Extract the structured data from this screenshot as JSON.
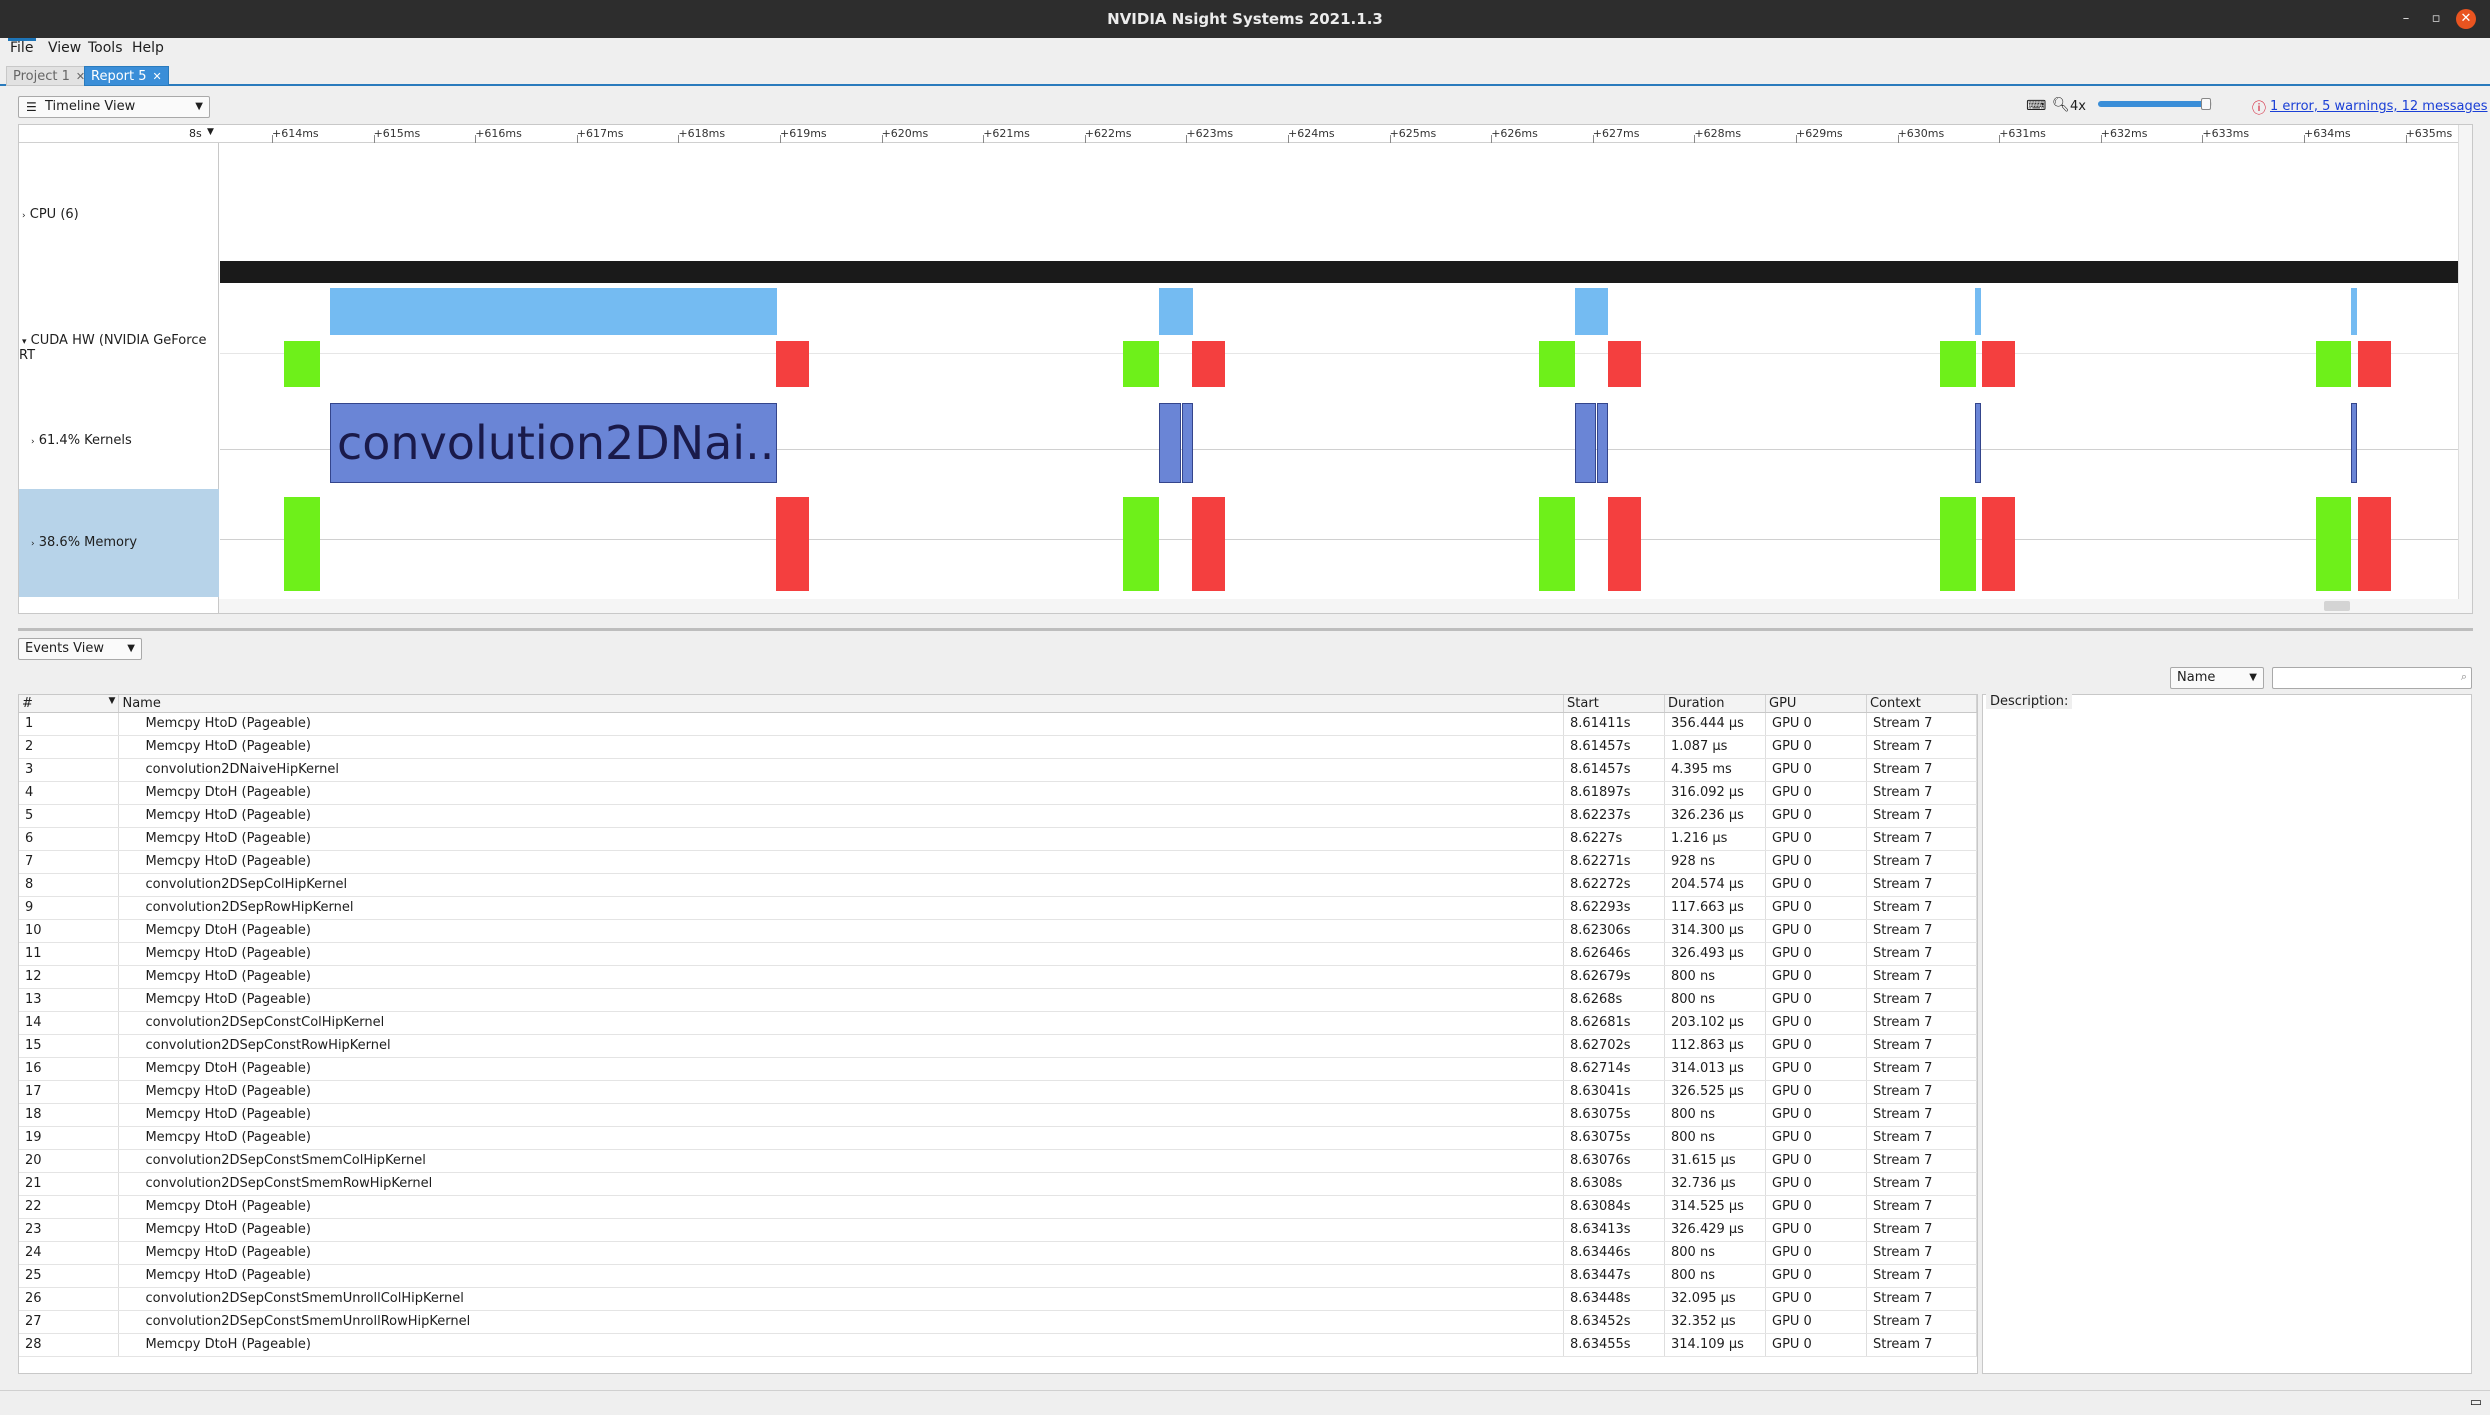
{
  "window": {
    "title": "NVIDIA Nsight Systems 2021.1.3",
    "minimize": "–",
    "restore": "▫",
    "close": "✕"
  },
  "menu": [
    "File",
    "View",
    "Tools",
    "Help"
  ],
  "tabs": [
    {
      "label": "Project 1"
    },
    {
      "label": "Report 5"
    }
  ],
  "timeline": {
    "view_select": "Timeline View",
    "zoom_label": "4x",
    "zoom_level_fraction": 0.95,
    "ruler_prefix": "8s",
    "messages": "1 error, 5 warnings, 12 messages",
    "ticks": [
      "+614ms",
      "+615ms",
      "+616ms",
      "+617ms",
      "+618ms",
      "+619ms",
      "+620ms",
      "+621ms",
      "+622ms",
      "+623ms",
      "+624ms",
      "+625ms",
      "+626ms",
      "+627ms",
      "+628ms",
      "+629ms",
      "+630ms",
      "+631ms",
      "+632ms",
      "+633ms",
      "+634ms",
      "+635ms"
    ],
    "rows": {
      "cpu": "CPU (6)",
      "cuda": "CUDA HW (NVIDIA GeForce RT",
      "kernels": "61.4% Kernels",
      "memory": "38.6% Memory"
    },
    "kernel_label": "convolution2DNai..."
  },
  "events": {
    "view_select": "Events View",
    "filter_select": "Name",
    "description_label": "Description:",
    "columns": [
      "#",
      "Name",
      "Start",
      "Duration",
      "GPU",
      "Context"
    ],
    "rows": [
      [
        "1",
        "Memcpy HtoD (Pageable)",
        "8.61411s",
        "356.444 μs",
        "GPU 0",
        "Stream 7"
      ],
      [
        "2",
        "Memcpy HtoD (Pageable)",
        "8.61457s",
        "1.087 μs",
        "GPU 0",
        "Stream 7"
      ],
      [
        "3",
        "convolution2DNaiveHipKernel",
        "8.61457s",
        "4.395 ms",
        "GPU 0",
        "Stream 7"
      ],
      [
        "4",
        "Memcpy DtoH (Pageable)",
        "8.61897s",
        "316.092 μs",
        "GPU 0",
        "Stream 7"
      ],
      [
        "5",
        "Memcpy HtoD (Pageable)",
        "8.62237s",
        "326.236 μs",
        "GPU 0",
        "Stream 7"
      ],
      [
        "6",
        "Memcpy HtoD (Pageable)",
        "8.6227s",
        "1.216 μs",
        "GPU 0",
        "Stream 7"
      ],
      [
        "7",
        "Memcpy HtoD (Pageable)",
        "8.62271s",
        "928 ns",
        "GPU 0",
        "Stream 7"
      ],
      [
        "8",
        "convolution2DSepColHipKernel",
        "8.62272s",
        "204.574 μs",
        "GPU 0",
        "Stream 7"
      ],
      [
        "9",
        "convolution2DSepRowHipKernel",
        "8.62293s",
        "117.663 μs",
        "GPU 0",
        "Stream 7"
      ],
      [
        "10",
        "Memcpy DtoH (Pageable)",
        "8.62306s",
        "314.300 μs",
        "GPU 0",
        "Stream 7"
      ],
      [
        "11",
        "Memcpy HtoD (Pageable)",
        "8.62646s",
        "326.493 μs",
        "GPU 0",
        "Stream 7"
      ],
      [
        "12",
        "Memcpy HtoD (Pageable)",
        "8.62679s",
        "800 ns",
        "GPU 0",
        "Stream 7"
      ],
      [
        "13",
        "Memcpy HtoD (Pageable)",
        "8.6268s",
        "800 ns",
        "GPU 0",
        "Stream 7"
      ],
      [
        "14",
        "convolution2DSepConstColHipKernel",
        "8.62681s",
        "203.102 μs",
        "GPU 0",
        "Stream 7"
      ],
      [
        "15",
        "convolution2DSepConstRowHipKernel",
        "8.62702s",
        "112.863 μs",
        "GPU 0",
        "Stream 7"
      ],
      [
        "16",
        "Memcpy DtoH (Pageable)",
        "8.62714s",
        "314.013 μs",
        "GPU 0",
        "Stream 7"
      ],
      [
        "17",
        "Memcpy HtoD (Pageable)",
        "8.63041s",
        "326.525 μs",
        "GPU 0",
        "Stream 7"
      ],
      [
        "18",
        "Memcpy HtoD (Pageable)",
        "8.63075s",
        "800 ns",
        "GPU 0",
        "Stream 7"
      ],
      [
        "19",
        "Memcpy HtoD (Pageable)",
        "8.63075s",
        "800 ns",
        "GPU 0",
        "Stream 7"
      ],
      [
        "20",
        "convolution2DSepConstSmemColHipKernel",
        "8.63076s",
        "31.615 μs",
        "GPU 0",
        "Stream 7"
      ],
      [
        "21",
        "convolution2DSepConstSmemRowHipKernel",
        "8.6308s",
        "32.736 μs",
        "GPU 0",
        "Stream 7"
      ],
      [
        "22",
        "Memcpy DtoH (Pageable)",
        "8.63084s",
        "314.525 μs",
        "GPU 0",
        "Stream 7"
      ],
      [
        "23",
        "Memcpy HtoD (Pageable)",
        "8.63413s",
        "326.429 μs",
        "GPU 0",
        "Stream 7"
      ],
      [
        "24",
        "Memcpy HtoD (Pageable)",
        "8.63446s",
        "800 ns",
        "GPU 0",
        "Stream 7"
      ],
      [
        "25",
        "Memcpy HtoD (Pageable)",
        "8.63447s",
        "800 ns",
        "GPU 0",
        "Stream 7"
      ],
      [
        "26",
        "convolution2DSepConstSmemUnrollColHipKernel",
        "8.63448s",
        "32.095 μs",
        "GPU 0",
        "Stream 7"
      ],
      [
        "27",
        "convolution2DSepConstSmemUnrollRowHipKernel",
        "8.63452s",
        "32.352 μs",
        "GPU 0",
        "Stream 7"
      ],
      [
        "28",
        "Memcpy DtoH (Pageable)",
        "8.63455s",
        "314.109 μs",
        "GPU 0",
        "Stream 7"
      ]
    ]
  },
  "colors": {
    "htod": "#6ef01a",
    "dtoh": "#f43f3f",
    "kernel": "#6a85d6",
    "cuda_hw": "#74bbf2",
    "accent": "#2a7bbd"
  }
}
